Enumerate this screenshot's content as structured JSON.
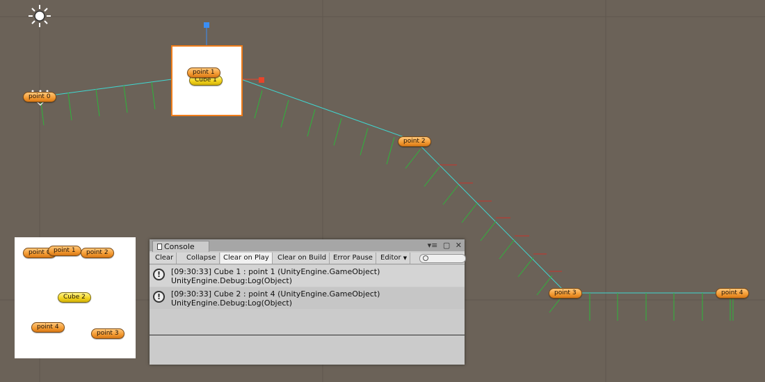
{
  "scene": {
    "grid_color": "#5f574e",
    "path_color": "#3fd8d2",
    "tick_color": "#2db53a",
    "red_tick_color": "#c8312a",
    "sun_icon": "directional-light-icon",
    "points": [
      {
        "label": "point 0"
      },
      {
        "label": "point 1"
      },
      {
        "label": "point 2"
      },
      {
        "label": "point 3"
      },
      {
        "label": "point 4"
      }
    ],
    "cube1_label": "Cube 1"
  },
  "preview": {
    "labels": [
      "point 0",
      "point 1",
      "point 2",
      "point 4",
      "point 3"
    ],
    "cube2_label": "Cube 2"
  },
  "console": {
    "tab_title": "Console",
    "toolbar": {
      "clear": "Clear",
      "collapse": "Collapse",
      "clear_on_play": "Clear on Play",
      "clear_on_build": "Clear on Build",
      "error_pause": "Error Pause",
      "editor": "Editor"
    },
    "logs": [
      {
        "line1": "[09:30:33] Cube 1 : point 1 (UnityEngine.GameObject)",
        "line2": "UnityEngine.Debug:Log(Object)"
      },
      {
        "line1": "[09:30:33] Cube 2 : point 4 (UnityEngine.GameObject)",
        "line2": "UnityEngine.Debug:Log(Object)"
      }
    ],
    "controls": {
      "menu_icon": "▾≡",
      "maximize_icon": "▢",
      "close_icon": "✕"
    }
  }
}
